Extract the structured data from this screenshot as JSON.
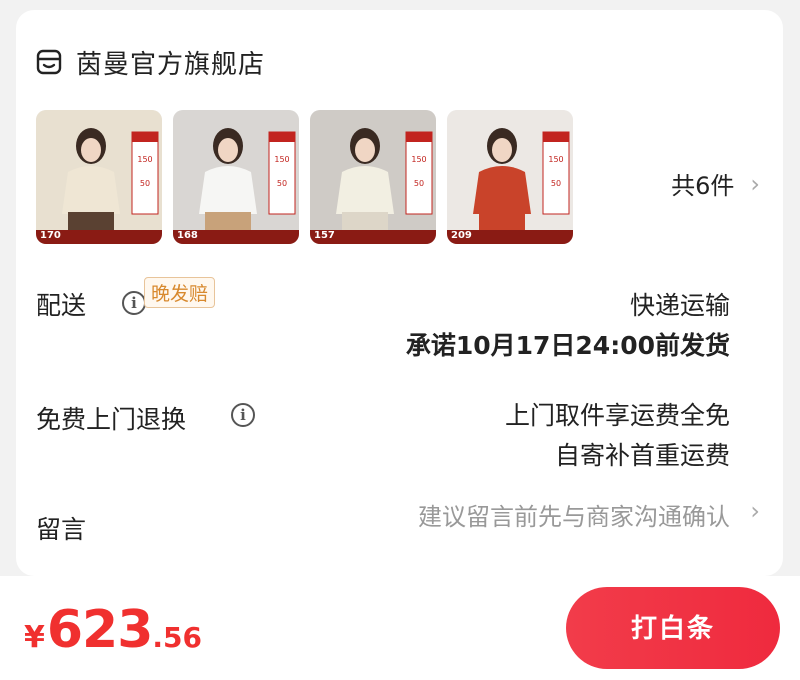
{
  "store": {
    "name": "茵曼官方旗舰店",
    "icon": "store-icon"
  },
  "products": {
    "items": [
      {
        "price": "170",
        "color": "#e8e0d0",
        "top": "#efe6d4",
        "bottom": "#5a4132"
      },
      {
        "price": "168",
        "color": "#d9d6d3",
        "top": "#f6f6f4",
        "bottom": "#c8a27a"
      },
      {
        "price": "157",
        "color": "#cfcbc6",
        "top": "#f2efe2",
        "bottom": "#ddd6c8"
      },
      {
        "price": "209",
        "color": "#ece8e4",
        "top": "#c9432a",
        "bottom": "#c9432a"
      }
    ],
    "count_label": "共6件"
  },
  "delivery": {
    "label": "配送",
    "badge": "晚发赔",
    "method": "快递运输",
    "promise": "承诺10月17日24:00前发货"
  },
  "returns": {
    "label": "免费上门退换",
    "line1": "上门取件享运费全免",
    "line2": "自寄补首重运费"
  },
  "message": {
    "label": "留言",
    "placeholder": "建议留言前先与商家沟通确认"
  },
  "footer": {
    "currency": "¥",
    "price_int": "623",
    "price_dec": ".56",
    "pay_label": "打白条"
  },
  "colors": {
    "accent": "#f0302f",
    "badge": "#d8892e"
  }
}
